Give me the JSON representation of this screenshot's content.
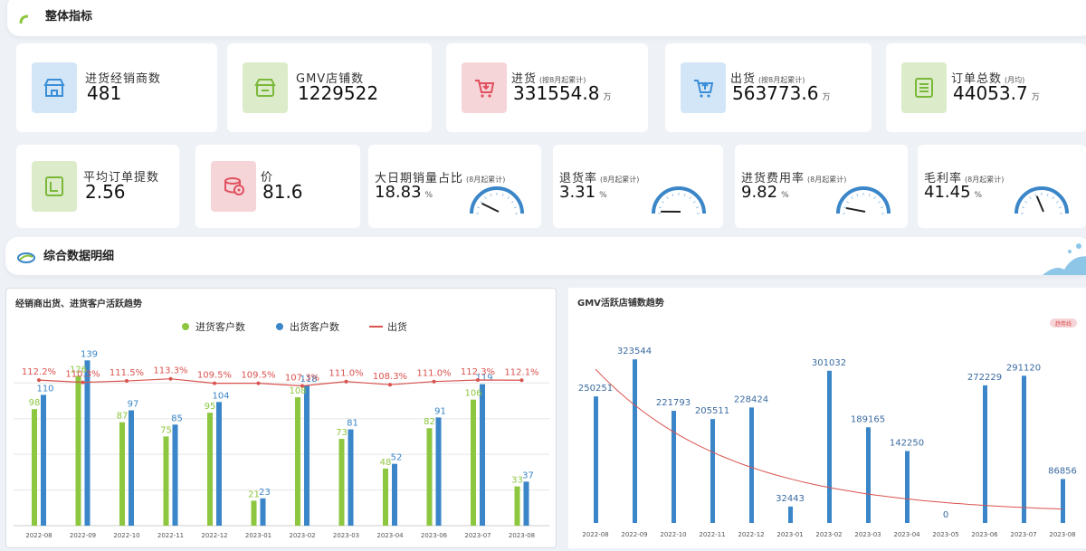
{
  "header_overall": {
    "title": "整体指标"
  },
  "header_detail": {
    "title": "综合数据明细"
  },
  "kpi_row1": [
    {
      "label": "进货经销商数",
      "sub": "",
      "value": "481",
      "unit": "",
      "icon": "store-icon",
      "bg": "#d3e6f7",
      "fg": "#3a8ed8"
    },
    {
      "label": "GMV店铺数",
      "sub": "",
      "value": "1229522",
      "unit": "",
      "icon": "shop-icon",
      "bg": "#dcebc9",
      "fg": "#7ab83a"
    },
    {
      "label": "进货",
      "sub": "(按8月起累计)",
      "value": "331554.8",
      "unit": "万",
      "icon": "cart-in-icon",
      "bg": "#f6d5d9",
      "fg": "#e0505e"
    },
    {
      "label": "出货",
      "sub": "(按8月起累计)",
      "value": "563773.6",
      "unit": "万",
      "icon": "cart-out-icon",
      "bg": "#d3e6f7",
      "fg": "#3a8ed8"
    },
    {
      "label": "订单总数",
      "sub": "(月均)",
      "value": "44053.7",
      "unit": "万",
      "icon": "order-icon",
      "bg": "#dcebc9",
      "fg": "#7ab83a"
    }
  ],
  "kpi_row2": [
    {
      "label": "平均订单提数",
      "sub": "",
      "value": "2.56",
      "unit": "",
      "icon": "ticket-icon",
      "bg": "#dcebc9",
      "fg": "#7ab83a"
    },
    {
      "label": "价",
      "sub": "",
      "value": "81.6",
      "unit": "",
      "icon": "coins-icon",
      "bg": "#f6d5d9",
      "fg": "#e0505e"
    }
  ],
  "kpi_gauges": [
    {
      "label": "大日期销量占比",
      "sub": "(8月起累计)",
      "value": "18.83",
      "unit": "%",
      "level": 0.1883
    },
    {
      "label": "退货率",
      "sub": "(8月起累计)",
      "value": "3.31",
      "unit": "%",
      "level": 0.0331
    },
    {
      "label": "进货费用率",
      "sub": "(8月起累计)",
      "value": "9.82",
      "unit": "%",
      "level": 0.0982
    },
    {
      "label": "毛利率",
      "sub": "(8月起累计)",
      "value": "41.45",
      "unit": "%",
      "level": 0.4145
    }
  ],
  "chart_data": [
    {
      "type": "bar",
      "title": "经销商出货、进货客户活跃趋势",
      "legend": [
        "进货客户数",
        "出货客户数",
        "出货"
      ],
      "legend_position": "top-center",
      "categories": [
        "2022-08",
        "2022-09",
        "2022-10",
        "2022-11",
        "2022-12",
        "2023-01",
        "2023-02",
        "2023-03",
        "2023-04",
        "2023-06",
        "2023-07",
        "2023-08"
      ],
      "series": [
        {
          "name": "进货客户数",
          "values": [
            98,
            126,
            87,
            75,
            95,
            21,
            108,
            73,
            48,
            82,
            106,
            33
          ],
          "color": "#8dc63f"
        },
        {
          "name": "出货客户数",
          "values": [
            110,
            139,
            97,
            85,
            104,
            23,
            118,
            81,
            52,
            91,
            119,
            37
          ],
          "color": "#3a86c8"
        }
      ],
      "line": {
        "name": "出货",
        "labels": [
          "112.2%",
          "110.3%",
          "111.5%",
          "113.3%",
          "109.5%",
          "109.5%",
          "107.3%",
          "111.0%",
          "108.3%",
          "111.0%",
          "112.3%",
          "112.1%"
        ],
        "values": [
          112.2,
          110.3,
          111.5,
          113.3,
          109.5,
          109.5,
          107.3,
          111.0,
          108.3,
          111.0,
          112.3,
          112.1
        ],
        "color": "#d9534f"
      },
      "ylim": [
        0,
        150
      ]
    },
    {
      "type": "bar",
      "title": "GMV活跃店铺数趋势",
      "badge": "趋势线",
      "categories": [
        "2022-08",
        "2022-09",
        "2022-10",
        "2022-11",
        "2022-12",
        "2023-01",
        "2023-02",
        "2023-03",
        "2023-04",
        "2023-05",
        "2023-06",
        "2023-07",
        "2023-08"
      ],
      "values": [
        250251,
        323544,
        221793,
        205511,
        228424,
        32443,
        301032,
        189165,
        142250,
        0,
        272229,
        291120,
        86856
      ],
      "color": "#3a86c8",
      "trendline_color": "#d9534f",
      "ylim": [
        0,
        340000
      ]
    }
  ]
}
